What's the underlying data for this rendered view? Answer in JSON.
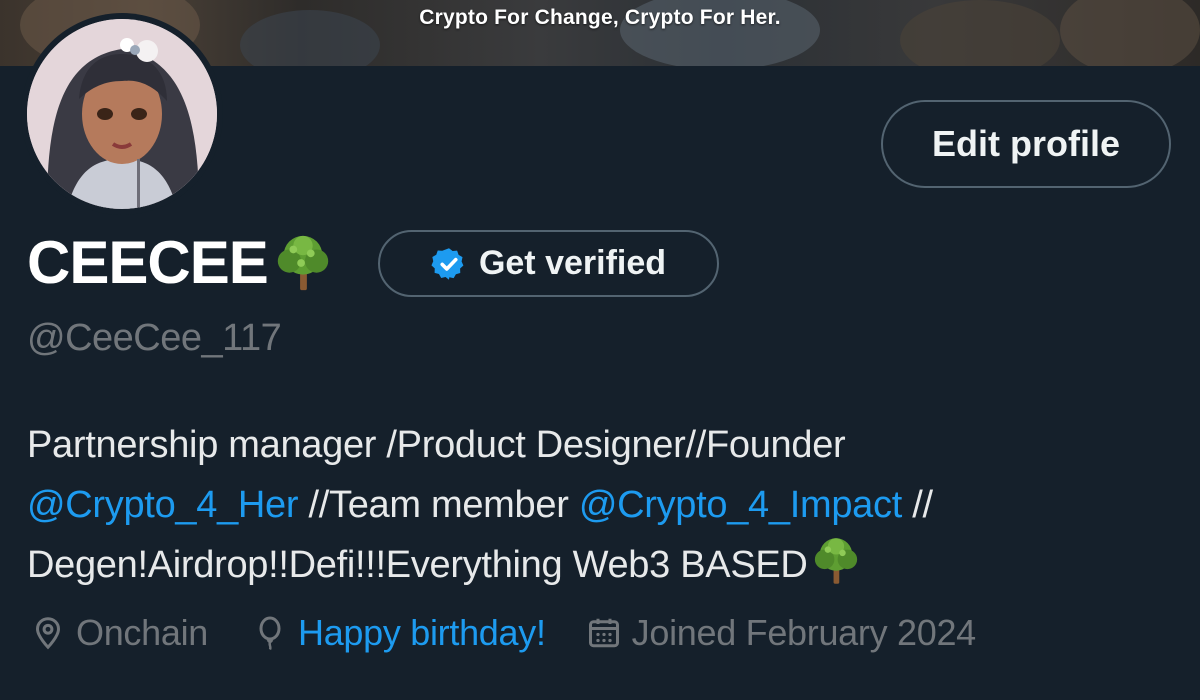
{
  "banner": {
    "text": "Crypto For Change, Crypto For Her."
  },
  "profile": {
    "display_name": "CEECEE",
    "handle": "@CeeCee_117",
    "edit_label": "Edit profile",
    "verify_label": "Get verified",
    "bio": {
      "line1": "Partnership manager /Product Designer//Founder",
      "mention1": "@Crypto_4_Her",
      "text2": " //Team member ",
      "mention2": "@Crypto_4_Impact",
      "text3": " //",
      "line3": "Degen!Airdrop!!Defi!!!Everything Web3 BASED"
    },
    "meta": {
      "location": "Onchain",
      "birthday": "Happy birthday!",
      "joined": "Joined February 2024"
    }
  },
  "icons": {
    "name_emoji": "tree-emoji",
    "verify": "verified-badge-icon",
    "location": "location-pin-icon",
    "birthday": "balloon-icon",
    "joined": "calendar-icon"
  },
  "colors": {
    "background": "#15202b",
    "accent": "#1d9bf0",
    "muted": "#71767b",
    "border": "#536471"
  }
}
